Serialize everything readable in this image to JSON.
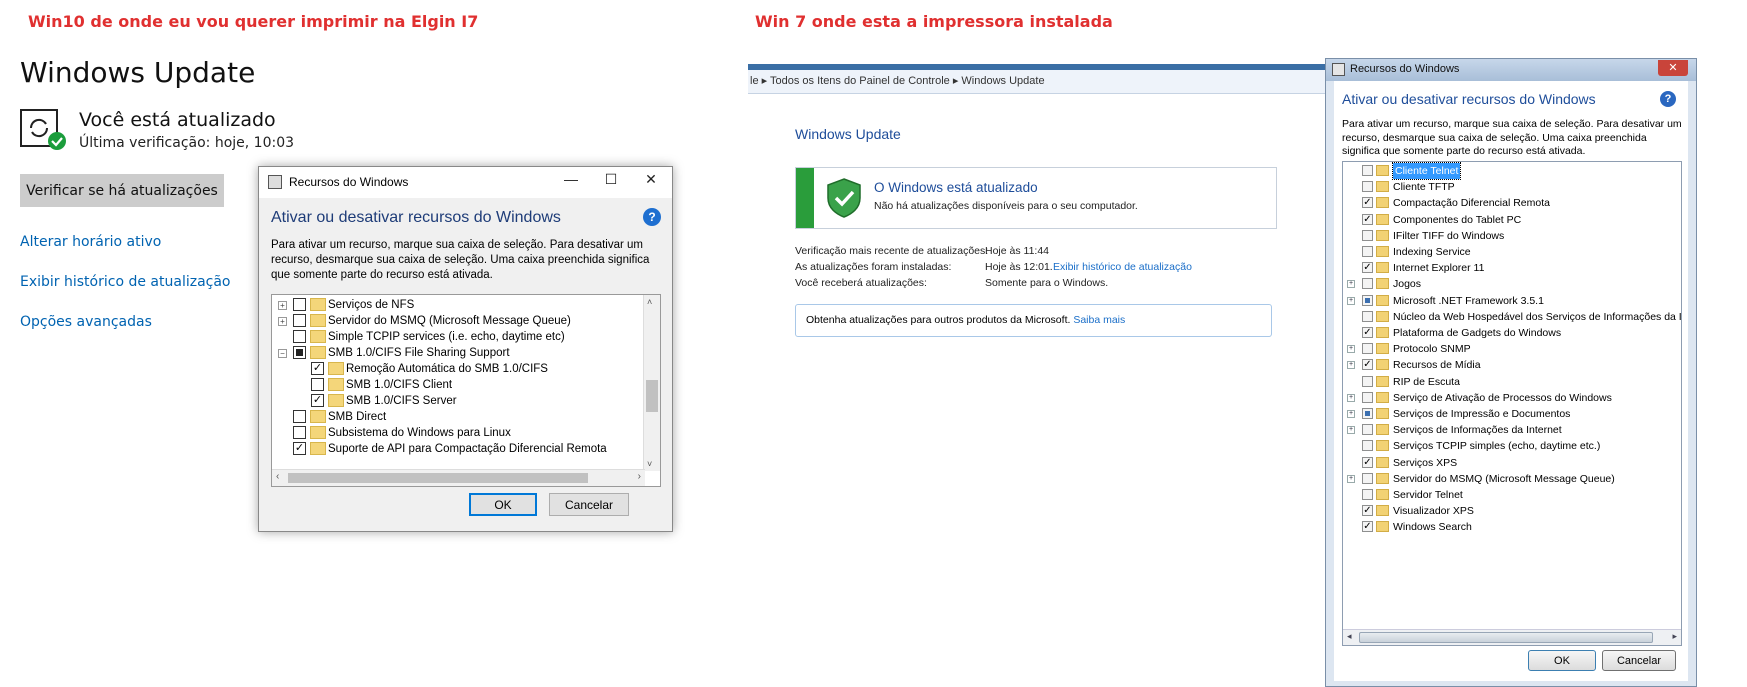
{
  "captions": {
    "left": "Win10 de onde eu vou querer imprimir na Elgin I7",
    "right": "Win 7 onde esta a impressora instalada"
  },
  "win10": {
    "title": "Windows Update",
    "status": "Você está atualizado",
    "last_check": "Última verificação: hoje, 10:03",
    "check_button": "Verificar se há atualizações",
    "links": [
      "Alterar horário ativo",
      "Exibir histórico de atualização",
      "Opções avançadas"
    ],
    "dialog": {
      "title": "Recursos do Windows",
      "heading": "Ativar ou desativar recursos do Windows",
      "help": "?",
      "description": "Para ativar um recurso, marque sua caixa de seleção. Para desativar um recurso, desmarque sua caixa de seleção. Uma caixa preenchida significa que somente parte do recurso está ativada.",
      "items": [
        {
          "label": "Serviços de NFS",
          "state": "unchecked",
          "expand": "+"
        },
        {
          "label": "Servidor do MSMQ (Microsoft Message Queue)",
          "state": "unchecked",
          "expand": "+"
        },
        {
          "label": "Simple TCPIP services (i.e. echo, daytime etc)",
          "state": "unchecked",
          "expand": ""
        },
        {
          "label": "SMB 1.0/CIFS File Sharing Support",
          "state": "partial",
          "expand": "-"
        },
        {
          "label": "Remoção Automática do SMB 1.0/CIFS",
          "state": "checked",
          "expand": "",
          "indent": 1
        },
        {
          "label": "SMB 1.0/CIFS Client",
          "state": "unchecked",
          "expand": "",
          "indent": 1
        },
        {
          "label": "SMB 1.0/CIFS Server",
          "state": "checked",
          "expand": "",
          "indent": 1
        },
        {
          "label": "SMB Direct",
          "state": "unchecked",
          "expand": ""
        },
        {
          "label": "Subsistema do Windows para Linux",
          "state": "unchecked",
          "expand": ""
        },
        {
          "label": "Suporte de API para Compactação Diferencial Remota",
          "state": "checked",
          "expand": ""
        }
      ],
      "ok": "OK",
      "cancel": "Cancelar"
    }
  },
  "win7": {
    "breadcrumb": "le  ▸  Todos os Itens do Painel de Controle  ▸  Windows Update",
    "title": "Windows Update",
    "status_title": "O Windows está atualizado",
    "status_sub": "Não há atualizações disponíveis para o seu computador.",
    "info": [
      {
        "label": "Verificação mais recente de atualizações:",
        "value": "Hoje às 11:44",
        "link": ""
      },
      {
        "label": "As atualizações foram instaladas:",
        "value": "Hoje às 12:01.",
        "link": "Exibir histórico de atualização"
      },
      {
        "label": "Você receberá atualizações:",
        "value": "Somente para o Windows.",
        "link": ""
      }
    ],
    "box_text": "Obtenha atualizações para outros produtos da Microsoft.",
    "box_link": "Saiba mais",
    "dialog": {
      "title": "Recursos do Windows",
      "heading": "Ativar ou desativar recursos do Windows",
      "help": "?",
      "description": "Para ativar um recurso, marque sua caixa de seleção. Para desativar um recurso, desmarque sua caixa de seleção. Uma caixa preenchida significa que somente parte do recurso está ativada.",
      "items": [
        {
          "label": "Cliente Telnet",
          "state": "unchecked",
          "expand": "",
          "selected": true
        },
        {
          "label": "Cliente TFTP",
          "state": "unchecked",
          "expand": ""
        },
        {
          "label": "Compactação Diferencial Remota",
          "state": "checked",
          "expand": ""
        },
        {
          "label": "Componentes do Tablet PC",
          "state": "checked",
          "expand": ""
        },
        {
          "label": "IFilter TIFF do Windows",
          "state": "unchecked",
          "expand": ""
        },
        {
          "label": "Indexing Service",
          "state": "unchecked",
          "expand": ""
        },
        {
          "label": "Internet Explorer 11",
          "state": "checked",
          "expand": ""
        },
        {
          "label": "Jogos",
          "state": "unchecked",
          "expand": "+"
        },
        {
          "label": "Microsoft .NET Framework 3.5.1",
          "state": "partial",
          "expand": "+"
        },
        {
          "label": "Núcleo da Web Hospedável dos Serviços de Informações da Inte",
          "state": "unchecked",
          "expand": ""
        },
        {
          "label": "Plataforma de Gadgets do Windows",
          "state": "checked",
          "expand": ""
        },
        {
          "label": "Protocolo SNMP",
          "state": "unchecked",
          "expand": "+"
        },
        {
          "label": "Recursos de Mídia",
          "state": "checked",
          "expand": "+"
        },
        {
          "label": "RIP de Escuta",
          "state": "unchecked",
          "expand": ""
        },
        {
          "label": "Serviço de Ativação de Processos do Windows",
          "state": "unchecked",
          "expand": "+"
        },
        {
          "label": "Serviços de Impressão e Documentos",
          "state": "partial",
          "expand": "+"
        },
        {
          "label": "Serviços de Informações da Internet",
          "state": "unchecked",
          "expand": "+"
        },
        {
          "label": "Serviços TCPIP simples (echo, daytime etc.)",
          "state": "unchecked",
          "expand": ""
        },
        {
          "label": "Serviços XPS",
          "state": "checked",
          "expand": ""
        },
        {
          "label": "Servidor do MSMQ (Microsoft Message Queue)",
          "state": "unchecked",
          "expand": "+"
        },
        {
          "label": "Servidor Telnet",
          "state": "unchecked",
          "expand": ""
        },
        {
          "label": "Visualizador XPS",
          "state": "checked",
          "expand": ""
        },
        {
          "label": "Windows Search",
          "state": "checked",
          "expand": ""
        }
      ],
      "ok": "OK",
      "cancel": "Cancelar"
    }
  }
}
